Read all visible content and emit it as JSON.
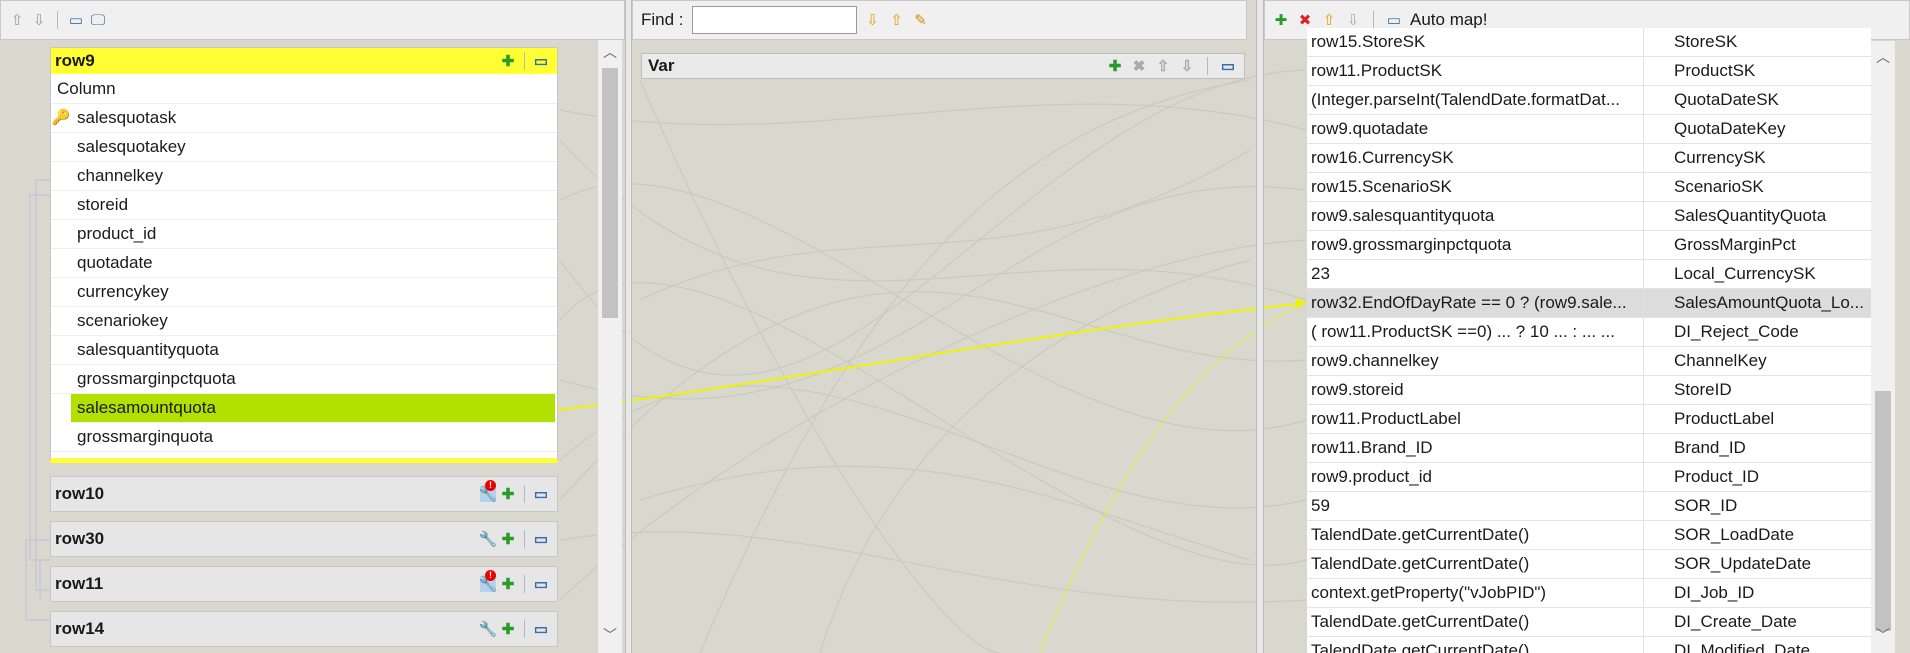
{
  "left_toolbar": {
    "icons": [
      "up-arrow-icon",
      "down-arrow-icon",
      "window-icon",
      "monitor-icon"
    ]
  },
  "center_toolbar": {
    "find_label": "Find :",
    "find_value": ""
  },
  "right_toolbar": {
    "auto_map_label": "Auto map!"
  },
  "var_panel": {
    "title": "Var"
  },
  "row9": {
    "title": "row9",
    "column_header": "Column",
    "columns": [
      {
        "name": "salesquotask",
        "key": true
      },
      {
        "name": "salesquotakey"
      },
      {
        "name": "channelkey"
      },
      {
        "name": "storeid"
      },
      {
        "name": "product_id"
      },
      {
        "name": "quotadate"
      },
      {
        "name": "currencykey"
      },
      {
        "name": "scenariokey"
      },
      {
        "name": "salesquantityquota"
      },
      {
        "name": "grossmarginpctquota"
      },
      {
        "name": "salesamountquota",
        "selected": true
      },
      {
        "name": "grossmarginquota"
      }
    ]
  },
  "collapsed_tables": [
    {
      "title": "row10",
      "badge": true
    },
    {
      "title": "row30",
      "badge": false
    },
    {
      "title": "row11",
      "badge": true
    },
    {
      "title": "row14",
      "badge": false
    }
  ],
  "output_rows": [
    {
      "expr": "row15.StoreSK",
      "col": "StoreSK"
    },
    {
      "expr": "row11.ProductSK",
      "col": "ProductSK"
    },
    {
      "expr": "(Integer.parseInt(TalendDate.formatDat...",
      "col": "QuotaDateSK"
    },
    {
      "expr": "row9.quotadate",
      "col": "QuotaDateKey"
    },
    {
      "expr": "row16.CurrencySK",
      "col": "CurrencySK"
    },
    {
      "expr": "row15.ScenarioSK",
      "col": "ScenarioSK"
    },
    {
      "expr": "row9.salesquantityquota",
      "col": "SalesQuantityQuota"
    },
    {
      "expr": "row9.grossmarginpctquota",
      "col": "GrossMarginPct"
    },
    {
      "expr": "23",
      "col": "Local_CurrencySK"
    },
    {
      "expr": "row32.EndOfDayRate == 0 ? (row9.sale...",
      "col": "SalesAmountQuota_Lo...",
      "highlight": true
    },
    {
      "expr": "( row11.ProductSK ==0) ...    ? 10 ...    : ... ...",
      "col": "DI_Reject_Code"
    },
    {
      "expr": "row9.channelkey",
      "col": "ChannelKey"
    },
    {
      "expr": "row9.storeid",
      "col": "StoreID"
    },
    {
      "expr": "row11.ProductLabel",
      "col": "ProductLabel"
    },
    {
      "expr": "row11.Brand_ID",
      "col": "Brand_ID"
    },
    {
      "expr": "row9.product_id",
      "col": "Product_ID"
    },
    {
      "expr": "59",
      "col": "SOR_ID"
    },
    {
      "expr": "TalendDate.getCurrentDate()",
      "col": "SOR_LoadDate"
    },
    {
      "expr": "TalendDate.getCurrentDate()",
      "col": "SOR_UpdateDate"
    },
    {
      "expr": "context.getProperty(\"vJobPID\")",
      "col": "DI_Job_ID"
    },
    {
      "expr": "TalendDate.getCurrentDate()",
      "col": "DI_Create_Date"
    },
    {
      "expr": "TalendDate.getCurrentDate()",
      "col": "DI_Modified_Date"
    }
  ],
  "colors": {
    "selected": "#b2e000",
    "row9_header": "#ffff33",
    "link": "#ffff33"
  }
}
